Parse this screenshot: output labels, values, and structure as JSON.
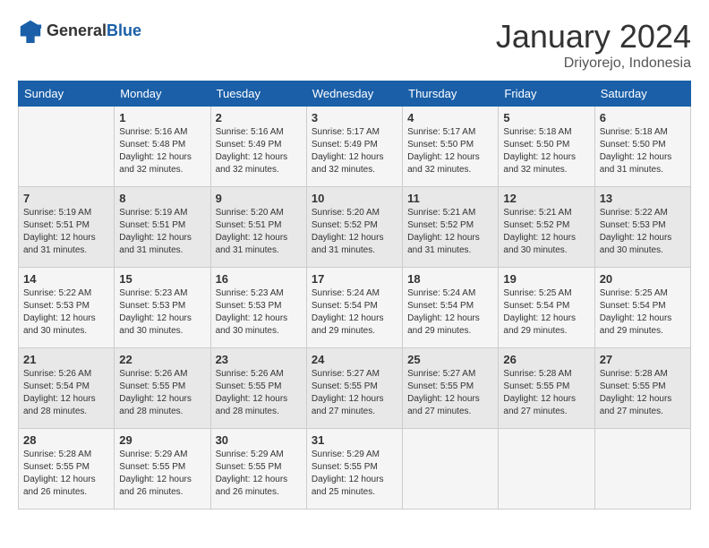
{
  "header": {
    "logo": {
      "general": "General",
      "blue": "Blue"
    },
    "title": "January 2024",
    "location": "Driyorejo, Indonesia"
  },
  "days_of_week": [
    "Sunday",
    "Monday",
    "Tuesday",
    "Wednesday",
    "Thursday",
    "Friday",
    "Saturday"
  ],
  "weeks": [
    [
      {
        "day": "",
        "info": ""
      },
      {
        "day": "1",
        "info": "Sunrise: 5:16 AM\nSunset: 5:48 PM\nDaylight: 12 hours\nand 32 minutes."
      },
      {
        "day": "2",
        "info": "Sunrise: 5:16 AM\nSunset: 5:49 PM\nDaylight: 12 hours\nand 32 minutes."
      },
      {
        "day": "3",
        "info": "Sunrise: 5:17 AM\nSunset: 5:49 PM\nDaylight: 12 hours\nand 32 minutes."
      },
      {
        "day": "4",
        "info": "Sunrise: 5:17 AM\nSunset: 5:50 PM\nDaylight: 12 hours\nand 32 minutes."
      },
      {
        "day": "5",
        "info": "Sunrise: 5:18 AM\nSunset: 5:50 PM\nDaylight: 12 hours\nand 32 minutes."
      },
      {
        "day": "6",
        "info": "Sunrise: 5:18 AM\nSunset: 5:50 PM\nDaylight: 12 hours\nand 31 minutes."
      }
    ],
    [
      {
        "day": "7",
        "info": "Sunrise: 5:19 AM\nSunset: 5:51 PM\nDaylight: 12 hours\nand 31 minutes."
      },
      {
        "day": "8",
        "info": "Sunrise: 5:19 AM\nSunset: 5:51 PM\nDaylight: 12 hours\nand 31 minutes."
      },
      {
        "day": "9",
        "info": "Sunrise: 5:20 AM\nSunset: 5:51 PM\nDaylight: 12 hours\nand 31 minutes."
      },
      {
        "day": "10",
        "info": "Sunrise: 5:20 AM\nSunset: 5:52 PM\nDaylight: 12 hours\nand 31 minutes."
      },
      {
        "day": "11",
        "info": "Sunrise: 5:21 AM\nSunset: 5:52 PM\nDaylight: 12 hours\nand 31 minutes."
      },
      {
        "day": "12",
        "info": "Sunrise: 5:21 AM\nSunset: 5:52 PM\nDaylight: 12 hours\nand 30 minutes."
      },
      {
        "day": "13",
        "info": "Sunrise: 5:22 AM\nSunset: 5:53 PM\nDaylight: 12 hours\nand 30 minutes."
      }
    ],
    [
      {
        "day": "14",
        "info": "Sunrise: 5:22 AM\nSunset: 5:53 PM\nDaylight: 12 hours\nand 30 minutes."
      },
      {
        "day": "15",
        "info": "Sunrise: 5:23 AM\nSunset: 5:53 PM\nDaylight: 12 hours\nand 30 minutes."
      },
      {
        "day": "16",
        "info": "Sunrise: 5:23 AM\nSunset: 5:53 PM\nDaylight: 12 hours\nand 30 minutes."
      },
      {
        "day": "17",
        "info": "Sunrise: 5:24 AM\nSunset: 5:54 PM\nDaylight: 12 hours\nand 29 minutes."
      },
      {
        "day": "18",
        "info": "Sunrise: 5:24 AM\nSunset: 5:54 PM\nDaylight: 12 hours\nand 29 minutes."
      },
      {
        "day": "19",
        "info": "Sunrise: 5:25 AM\nSunset: 5:54 PM\nDaylight: 12 hours\nand 29 minutes."
      },
      {
        "day": "20",
        "info": "Sunrise: 5:25 AM\nSunset: 5:54 PM\nDaylight: 12 hours\nand 29 minutes."
      }
    ],
    [
      {
        "day": "21",
        "info": "Sunrise: 5:26 AM\nSunset: 5:54 PM\nDaylight: 12 hours\nand 28 minutes."
      },
      {
        "day": "22",
        "info": "Sunrise: 5:26 AM\nSunset: 5:55 PM\nDaylight: 12 hours\nand 28 minutes."
      },
      {
        "day": "23",
        "info": "Sunrise: 5:26 AM\nSunset: 5:55 PM\nDaylight: 12 hours\nand 28 minutes."
      },
      {
        "day": "24",
        "info": "Sunrise: 5:27 AM\nSunset: 5:55 PM\nDaylight: 12 hours\nand 27 minutes."
      },
      {
        "day": "25",
        "info": "Sunrise: 5:27 AM\nSunset: 5:55 PM\nDaylight: 12 hours\nand 27 minutes."
      },
      {
        "day": "26",
        "info": "Sunrise: 5:28 AM\nSunset: 5:55 PM\nDaylight: 12 hours\nand 27 minutes."
      },
      {
        "day": "27",
        "info": "Sunrise: 5:28 AM\nSunset: 5:55 PM\nDaylight: 12 hours\nand 27 minutes."
      }
    ],
    [
      {
        "day": "28",
        "info": "Sunrise: 5:28 AM\nSunset: 5:55 PM\nDaylight: 12 hours\nand 26 minutes."
      },
      {
        "day": "29",
        "info": "Sunrise: 5:29 AM\nSunset: 5:55 PM\nDaylight: 12 hours\nand 26 minutes."
      },
      {
        "day": "30",
        "info": "Sunrise: 5:29 AM\nSunset: 5:55 PM\nDaylight: 12 hours\nand 26 minutes."
      },
      {
        "day": "31",
        "info": "Sunrise: 5:29 AM\nSunset: 5:55 PM\nDaylight: 12 hours\nand 25 minutes."
      },
      {
        "day": "",
        "info": ""
      },
      {
        "day": "",
        "info": ""
      },
      {
        "day": "",
        "info": ""
      }
    ]
  ]
}
